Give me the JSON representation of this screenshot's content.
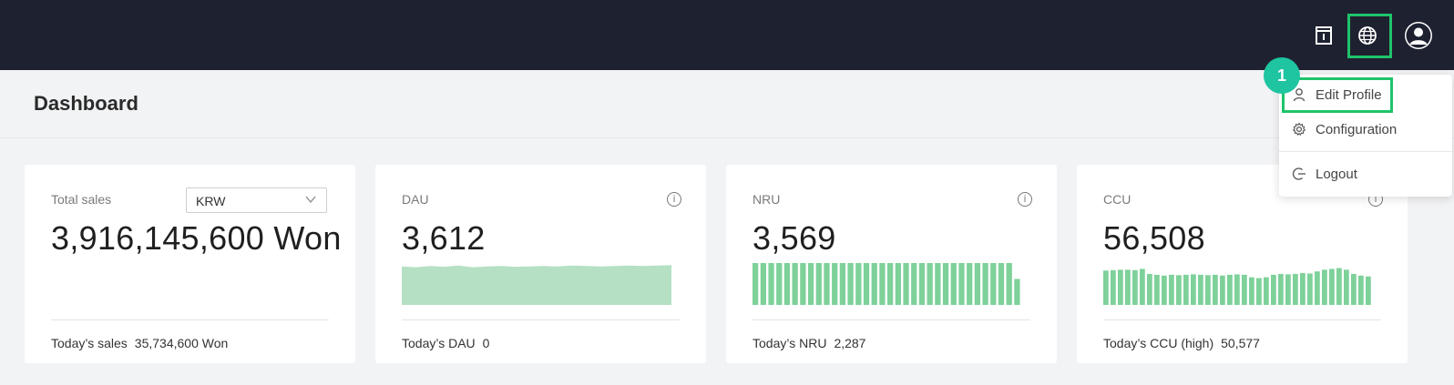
{
  "header": {
    "icons": [
      "document-icon",
      "globe-icon",
      "user-avatar-icon"
    ]
  },
  "page": {
    "title": "Dashboard"
  },
  "cards": {
    "sales": {
      "label": "Total sales",
      "currency": "KRW",
      "value": "3,916,145,600 Won",
      "footer_label": "Today’s sales",
      "footer_value": "35,734,600 Won"
    },
    "dau": {
      "label": "DAU",
      "value": "3,612",
      "footer_label": "Today’s DAU",
      "footer_value": "0"
    },
    "nru": {
      "label": "NRU",
      "value": "3,569",
      "footer_label": "Today’s NRU",
      "footer_value": "2,287"
    },
    "ccu": {
      "label": "CCU",
      "value": "56,508",
      "footer_label": "Today’s CCU (high)",
      "footer_value": "50,577"
    }
  },
  "sparklines": {
    "dau": [
      0.92,
      0.9,
      0.93,
      0.91,
      0.94,
      0.9,
      0.92,
      0.93,
      0.91,
      0.92,
      0.93,
      0.92,
      0.94,
      0.93,
      0.92,
      0.93,
      0.94,
      0.93,
      0.94,
      0.95
    ],
    "nru": [
      1,
      1,
      1,
      1,
      1,
      1,
      1,
      1,
      1,
      1,
      1,
      1,
      1,
      1,
      1,
      1,
      1,
      1,
      1,
      1,
      1,
      1,
      1,
      1,
      1,
      1,
      1,
      1,
      1,
      1,
      1,
      1,
      1,
      0.62
    ],
    "ccu": [
      0.82,
      0.83,
      0.84,
      0.84,
      0.83,
      0.86,
      0.74,
      0.72,
      0.7,
      0.72,
      0.71,
      0.72,
      0.73,
      0.72,
      0.71,
      0.72,
      0.7,
      0.72,
      0.73,
      0.72,
      0.66,
      0.64,
      0.66,
      0.72,
      0.74,
      0.73,
      0.74,
      0.76,
      0.75,
      0.8,
      0.84,
      0.86,
      0.88,
      0.84,
      0.74,
      0.7,
      0.68
    ]
  },
  "colors": {
    "accent": "#1fc46b",
    "chart_fill": "#b5e0c4",
    "bar_fill": "#7ed199",
    "topbar": "#1e2130",
    "badge": "#1fc4a0"
  },
  "dropdown": {
    "items": [
      {
        "label": "Edit Profile",
        "icon": "user-icon"
      },
      {
        "label": "Configuration",
        "icon": "gear-icon"
      },
      {
        "label": "Logout",
        "icon": "logout-icon"
      }
    ]
  },
  "annotation": {
    "badge": "1"
  }
}
